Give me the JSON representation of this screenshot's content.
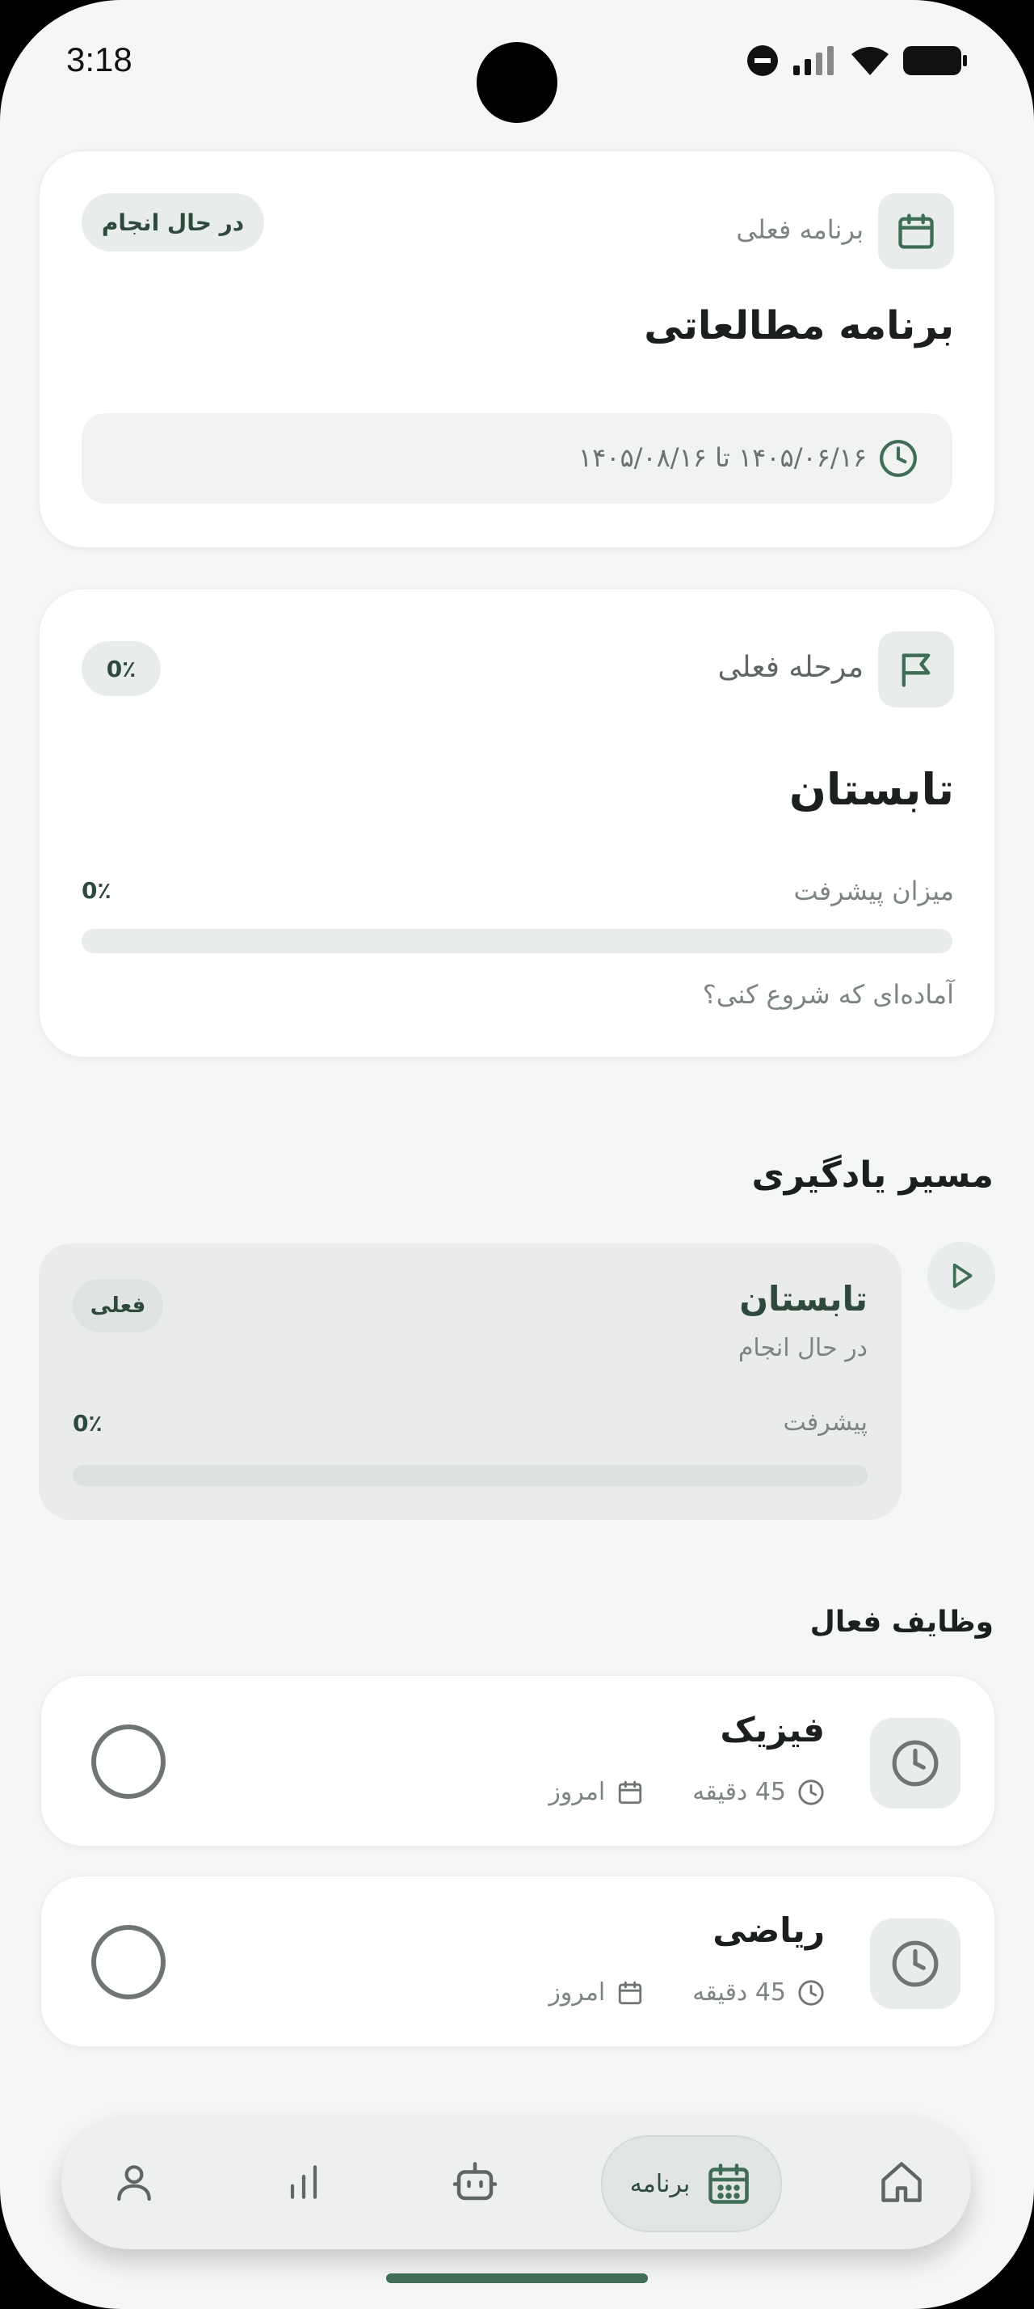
{
  "status_bar": {
    "time": "3:18"
  },
  "current_program": {
    "label": "برنامه فعلی",
    "badge": "در حال انجام",
    "title": "برنامه مطالعاتی",
    "date_range": "۱۴۰۵/۰۶/۱۶ تا ۱۴۰۵/۰۸/۱۶"
  },
  "current_stage": {
    "label": "مرحله فعلی",
    "badge": "0٪",
    "title": "تابستان",
    "progress_label": "میزان پیشرفت",
    "progress_value_text": "0٪",
    "progress": 0,
    "hint": "آماده‌ای که شروع کنی؟"
  },
  "learning_path": {
    "heading": "مسیر یادگیری",
    "stage": {
      "title": "تابستان",
      "status": "در حال انجام",
      "badge": "فعلی",
      "progress_label": "پیشرفت",
      "progress_value_text": "0٪",
      "progress": 0
    }
  },
  "active_tasks": {
    "heading": "وظایف فعال",
    "items": [
      {
        "title": "فیزیک",
        "duration": "45 دقیقه",
        "date": "امروز"
      },
      {
        "title": "ریاضی",
        "duration": "45 دقیقه",
        "date": "امروز"
      }
    ]
  },
  "bottom_nav": {
    "active_label": "برنامه",
    "items": [
      "home-icon",
      "calendar-icon",
      "robot-icon",
      "chart-icon",
      "profile-icon"
    ]
  },
  "colors": {
    "accent": "#3f6d55",
    "muted_bg": "#e8ecea",
    "page_bg": "#f5f6f7"
  }
}
